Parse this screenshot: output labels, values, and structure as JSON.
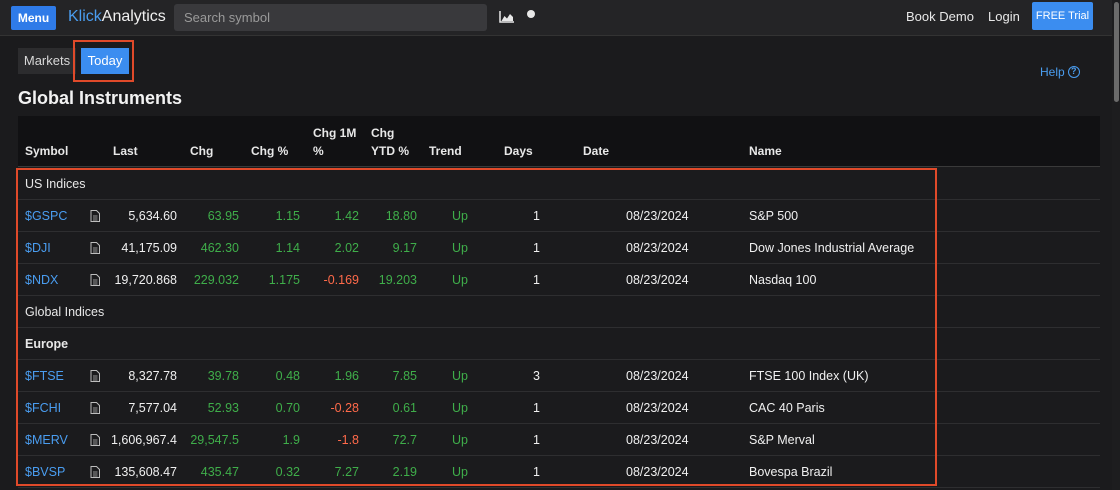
{
  "header": {
    "menu_label": "Menu",
    "brand_part1": "Klick",
    "brand_part2": "Analytics",
    "search_placeholder": "Search symbol",
    "book_demo": "Book Demo",
    "login": "Login",
    "trial": "FREE Trial"
  },
  "tabs": {
    "markets": "Markets",
    "today": "Today"
  },
  "help_label": "Help",
  "help_icon": "?",
  "page_title": "Global Instruments",
  "table": {
    "headers": {
      "symbol": "Symbol",
      "last": "Last",
      "chg": "Chg",
      "chg_pct": "Chg %",
      "chg_1m_line1": "Chg 1M",
      "chg_1m_line2": "%",
      "chg_ytd_line1": "Chg",
      "chg_ytd_line2": "YTD %",
      "trend": "Trend",
      "days": "Days",
      "date": "Date",
      "name": "Name"
    },
    "groups": {
      "us": "US Indices",
      "global": "Global Indices",
      "europe": "Europe"
    },
    "rows": [
      {
        "symbol": "$GSPC",
        "last": "5,634.60",
        "chg": "63.95",
        "chg_pct": "1.15",
        "chg_1m": "1.42",
        "chg_ytd": "18.80",
        "trend": "Up",
        "days": "1",
        "date": "08/23/2024",
        "name": "S&P 500"
      },
      {
        "symbol": "$DJI",
        "last": "41,175.09",
        "chg": "462.30",
        "chg_pct": "1.14",
        "chg_1m": "2.02",
        "chg_ytd": "9.17",
        "trend": "Up",
        "days": "1",
        "date": "08/23/2024",
        "name": "Dow Jones Industrial Average"
      },
      {
        "symbol": "$NDX",
        "last": "19,720.868",
        "chg": "229.032",
        "chg_pct": "1.175",
        "chg_1m": "-0.169",
        "chg_ytd": "19.203",
        "trend": "Up",
        "days": "1",
        "date": "08/23/2024",
        "name": "Nasdaq 100"
      },
      {
        "symbol": "$FTSE",
        "last": "8,327.78",
        "chg": "39.78",
        "chg_pct": "0.48",
        "chg_1m": "1.96",
        "chg_ytd": "7.85",
        "trend": "Up",
        "days": "3",
        "date": "08/23/2024",
        "name": "FTSE 100 Index (UK)"
      },
      {
        "symbol": "$FCHI",
        "last": "7,577.04",
        "chg": "52.93",
        "chg_pct": "0.70",
        "chg_1m": "-0.28",
        "chg_ytd": "0.61",
        "trend": "Up",
        "days": "1",
        "date": "08/23/2024",
        "name": "CAC 40 Paris"
      },
      {
        "symbol": "$MERV",
        "last": "1,606,967.4",
        "chg": "29,547.5",
        "chg_pct": "1.9",
        "chg_1m": "-1.8",
        "chg_ytd": "72.7",
        "trend": "Up",
        "days": "1",
        "date": "08/23/2024",
        "name": "S&P Merval"
      },
      {
        "symbol": "$BVSP",
        "last": "135,608.47",
        "chg": "435.47",
        "chg_pct": "0.32",
        "chg_1m": "7.27",
        "chg_ytd": "2.19",
        "trend": "Up",
        "days": "1",
        "date": "08/23/2024",
        "name": "Bovespa Brazil"
      }
    ]
  },
  "colors": {
    "positive": "#3fae4a",
    "negative": "#ff6a4a",
    "accent": "#3b8df0",
    "highlight": "#e04a2a"
  }
}
